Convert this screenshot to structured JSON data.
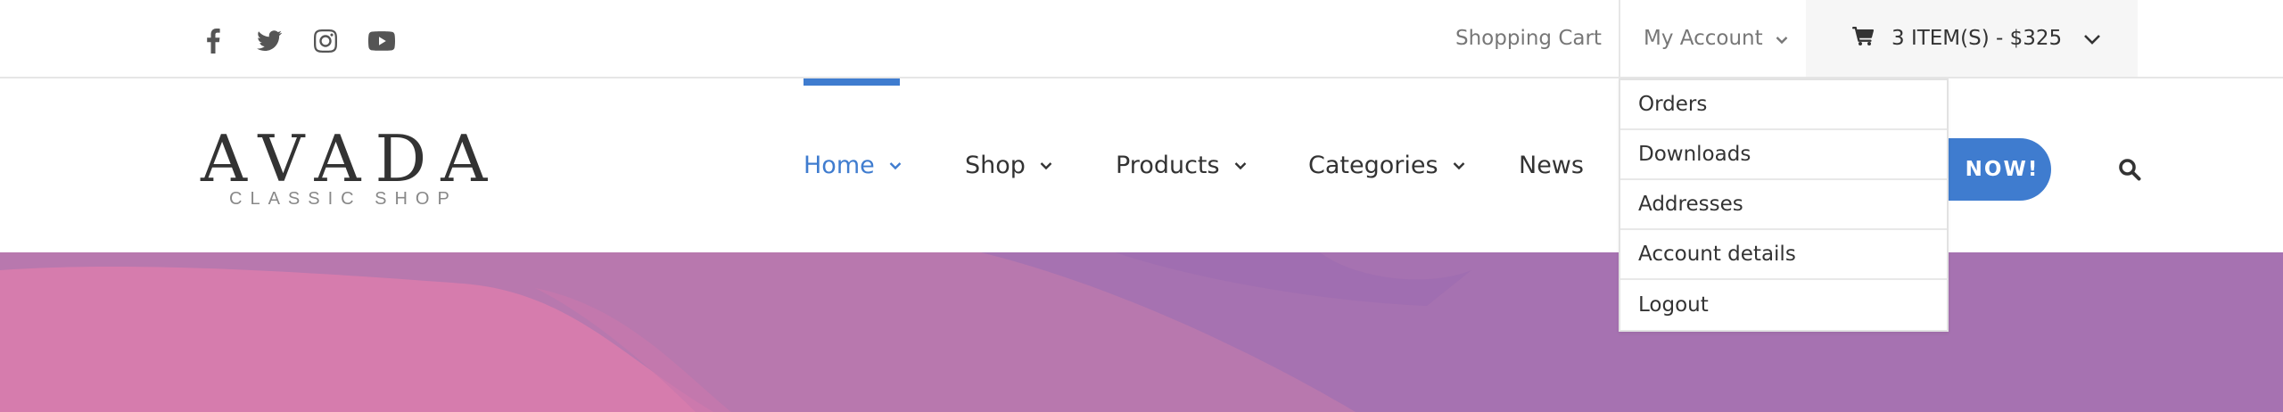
{
  "topbar": {
    "social": [
      {
        "name": "facebook-icon"
      },
      {
        "name": "twitter-icon"
      },
      {
        "name": "instagram-icon"
      },
      {
        "name": "youtube-icon"
      }
    ],
    "shopping_cart_label": "Shopping Cart",
    "my_account_label": "My Account",
    "cart_summary": "3 ITEM(S) - $325"
  },
  "logo": {
    "main": "AVADA",
    "sub": "CLASSIC SHOP"
  },
  "nav": {
    "items": [
      {
        "label": "Home",
        "has_dropdown": true,
        "active": true
      },
      {
        "label": "Shop",
        "has_dropdown": true
      },
      {
        "label": "Products",
        "has_dropdown": true
      },
      {
        "label": "Categories",
        "has_dropdown": true
      },
      {
        "label": "News",
        "has_dropdown": false
      }
    ],
    "cta_label": "NOW!"
  },
  "account_menu": {
    "items": [
      "Orders",
      "Downloads",
      "Addresses",
      "Account details",
      "Logout"
    ]
  },
  "colors": {
    "accent": "#3f7ccf",
    "hero_pink": "#d67cad",
    "hero_mauve": "#b878ae",
    "hero_purple": "#a672b1"
  }
}
